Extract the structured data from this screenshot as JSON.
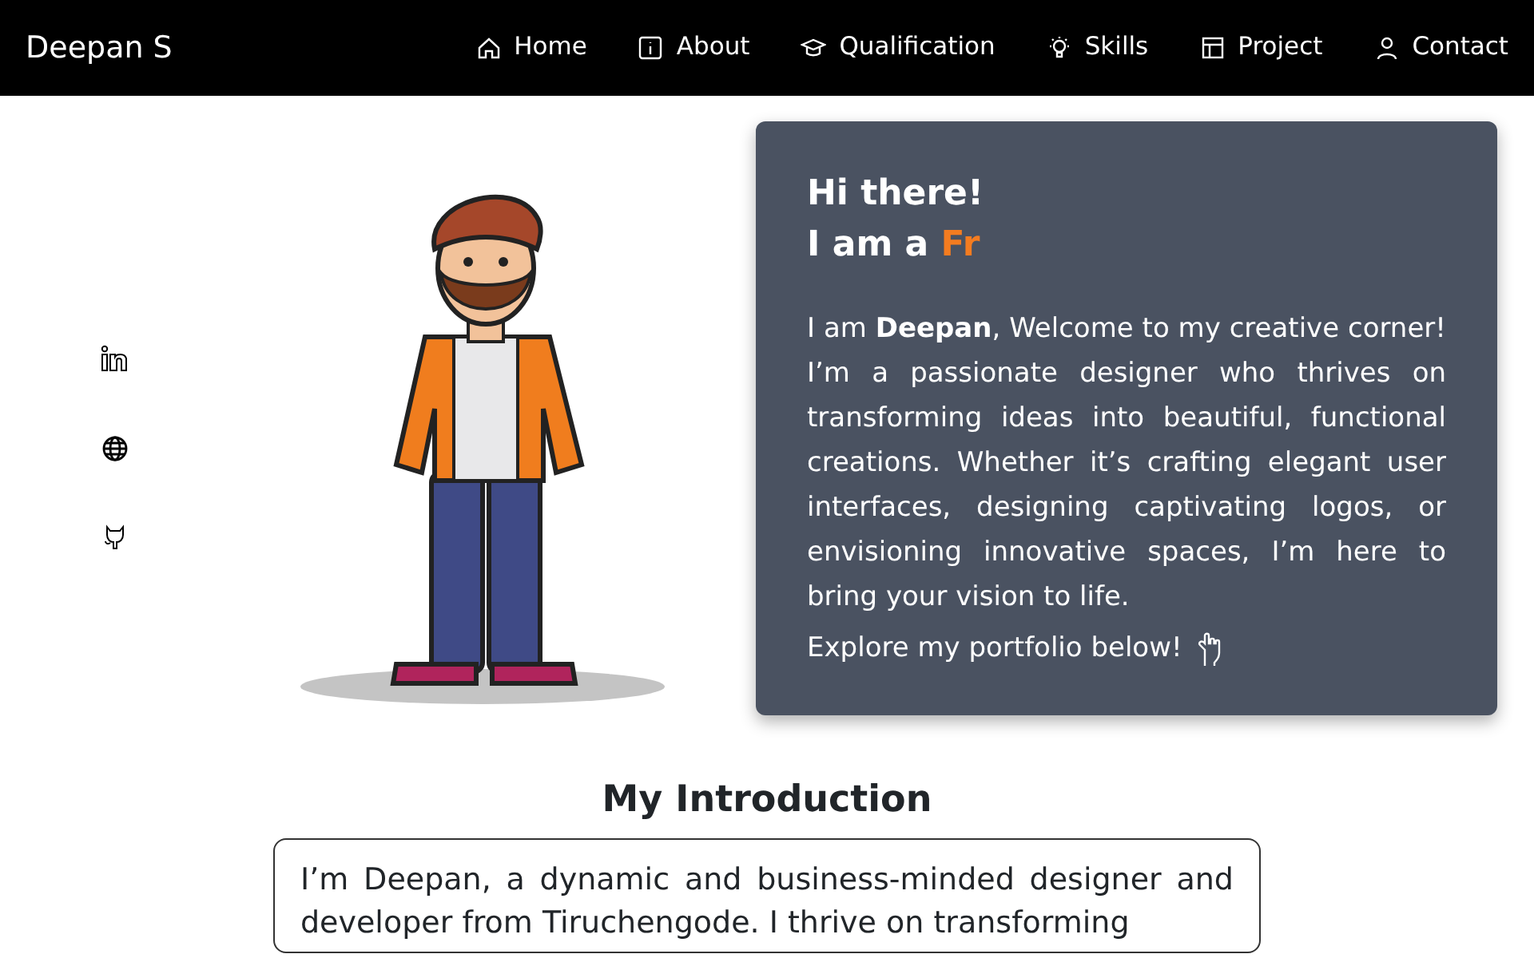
{
  "navbar": {
    "brand": "Deepan S",
    "items": [
      {
        "label": "Home"
      },
      {
        "label": "About"
      },
      {
        "label": "Qualification"
      },
      {
        "label": "Skills"
      },
      {
        "label": "Project"
      },
      {
        "label": "Contact"
      }
    ]
  },
  "hero": {
    "greeting": "Hi there!",
    "tagline": "I am a",
    "typed_text": "Fr",
    "bio": "I am **Deepan**, Welcome to my creative corner! I’m a passionate designer who thrives on transforming ideas into beautiful, functional creations. Whether it’s crafting elegant user interfaces, designing captivating logos, or envisioning innovative spaces, I’m here to bring your vision to life.",
    "explore": "Explore my portfolio below!"
  },
  "introduction": {
    "heading": "My Introduction",
    "text": "I’m Deepan, a dynamic and business-minded designer and developer from Tiruchengode. I thrive on transforming"
  }
}
